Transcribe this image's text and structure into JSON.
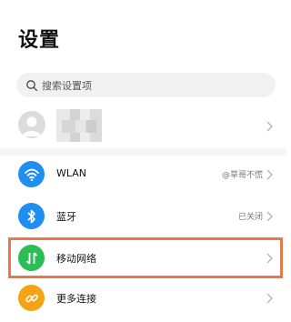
{
  "header": {
    "title": "设置"
  },
  "search": {
    "placeholder": "搜索设置项"
  },
  "account": {
    "blurred": true
  },
  "settings_items": [
    {
      "label": "WLAN",
      "value": "@草哥不慌",
      "icon": "wifi-icon",
      "color": "#1e8ef0"
    },
    {
      "label": "蓝牙",
      "value": "已关闭",
      "icon": "bluetooth-icon",
      "color": "#1e8ef0"
    },
    {
      "label": "移动网络",
      "value": "",
      "icon": "mobile-data-icon",
      "color": "#2bbd56"
    },
    {
      "label": "更多连接",
      "value": "",
      "icon": "link-icon",
      "color": "#f3a314"
    }
  ],
  "colors": {
    "highlight_border": "#e8784a",
    "chevron": "#b3b3b3"
  }
}
